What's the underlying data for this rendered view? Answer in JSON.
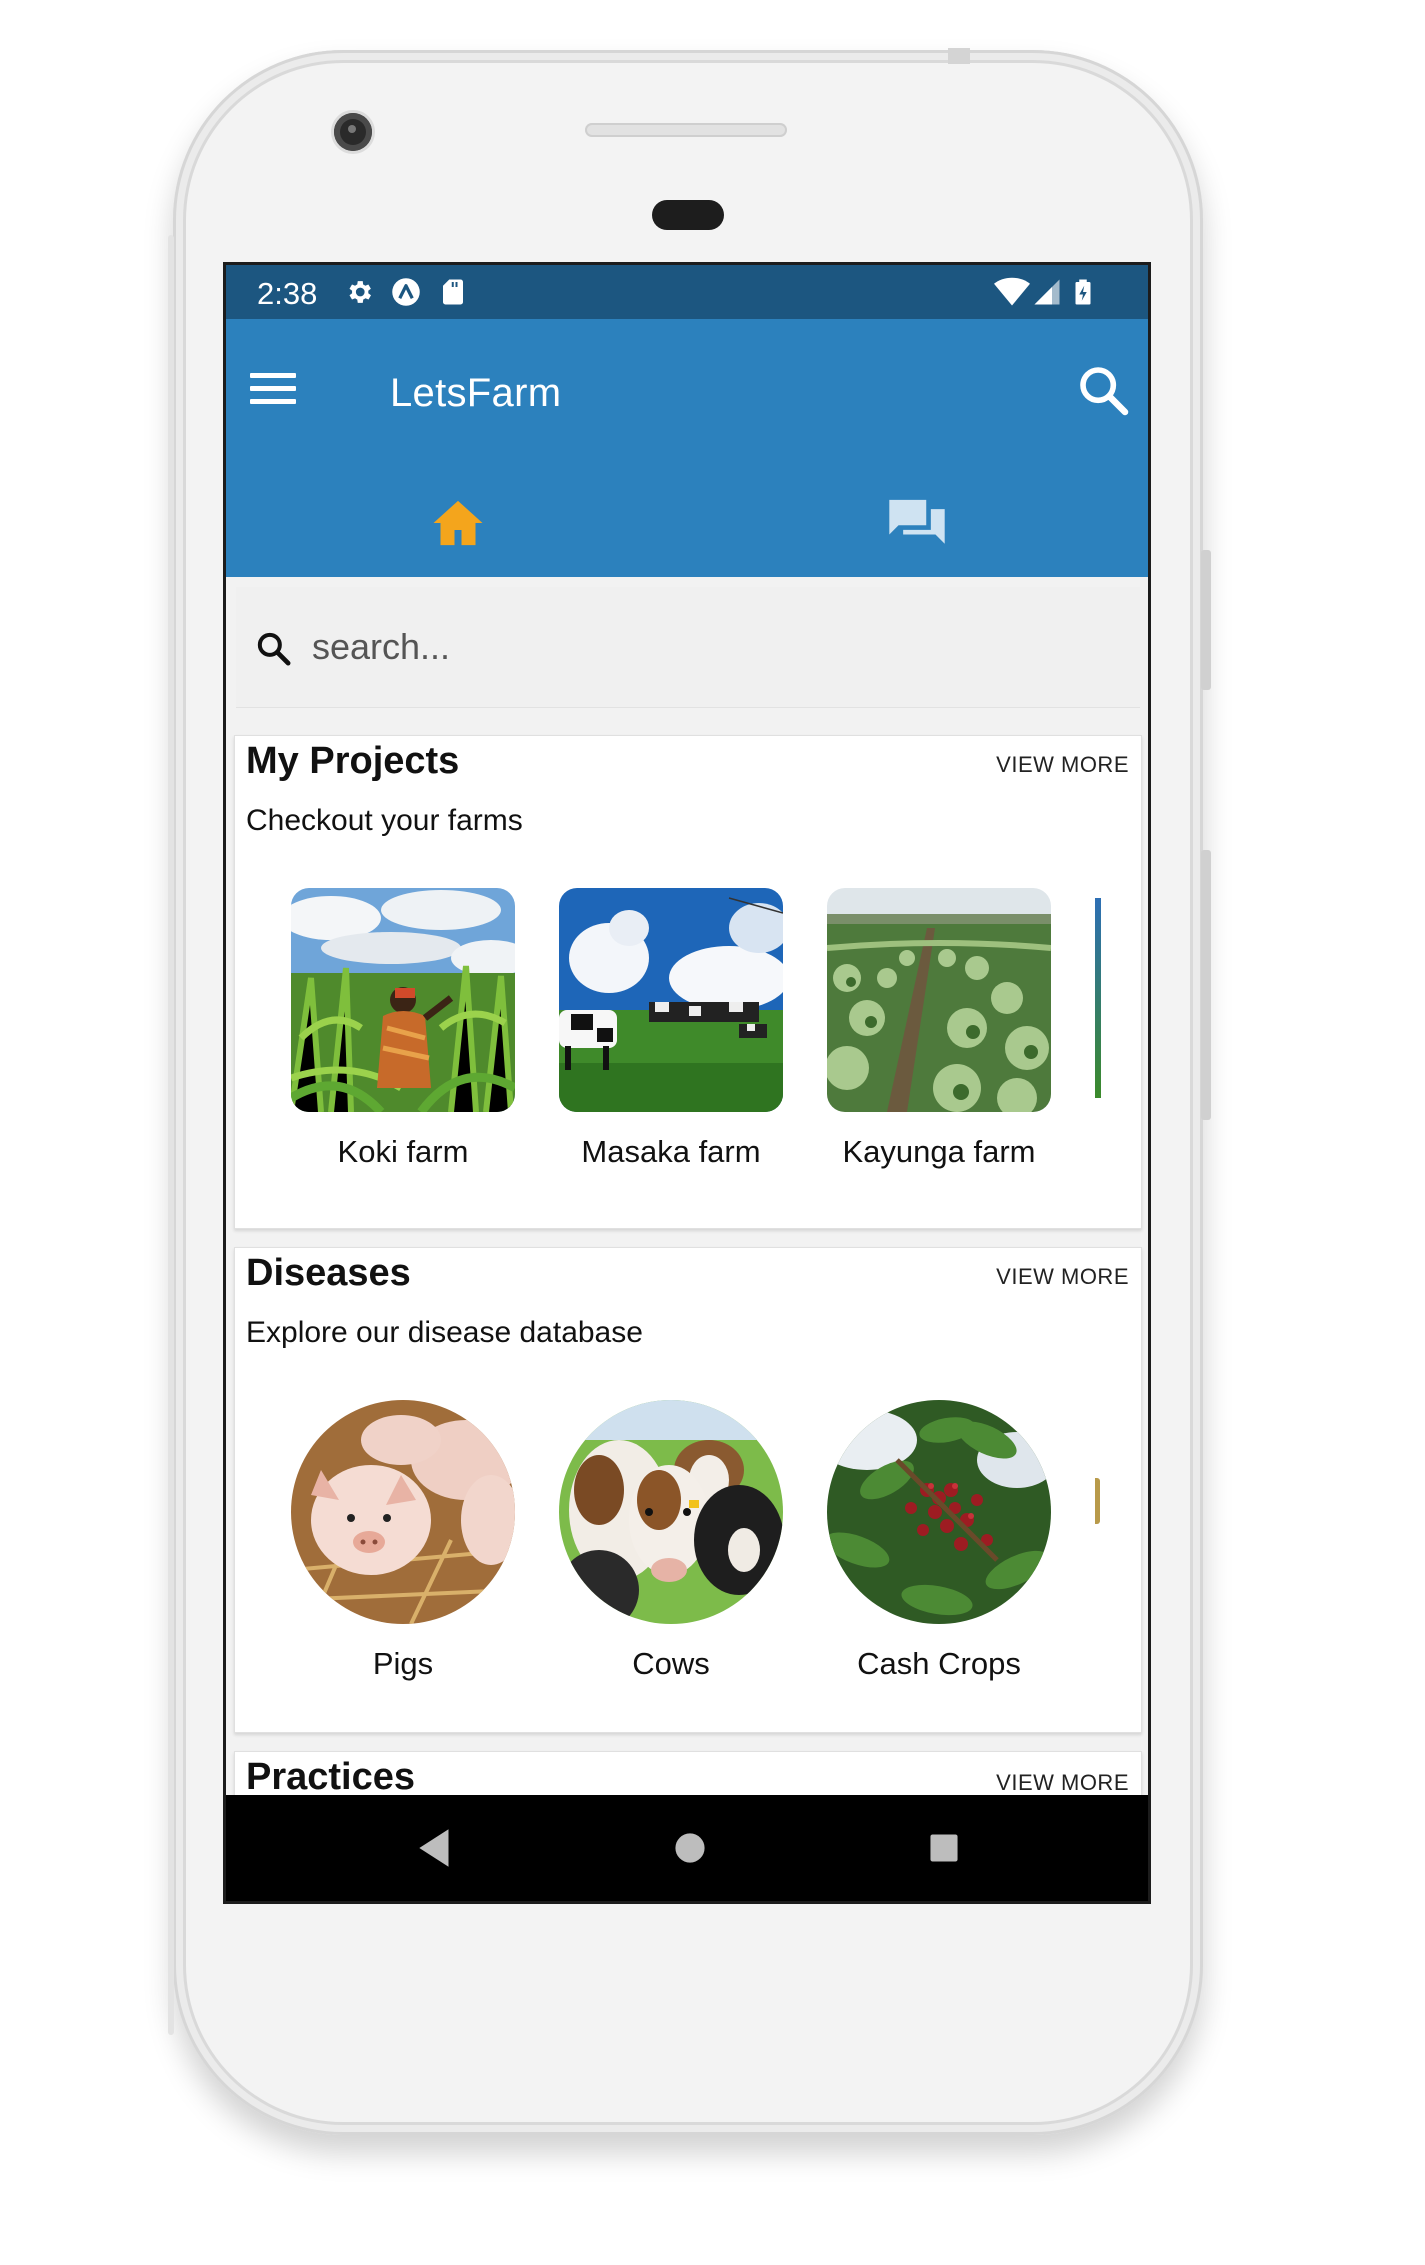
{
  "status_bar": {
    "time": "2:38",
    "left_icons": [
      "settings-icon",
      "a-circle-icon",
      "sd-card-icon"
    ],
    "right_icons": [
      "wifi-icon",
      "cell-signal-icon",
      "battery-icon"
    ]
  },
  "app_bar": {
    "title": "LetsFarm",
    "menu_icon": "hamburger-menu-icon",
    "search_icon": "search-icon",
    "color": "#2c81bd",
    "status_color": "#1c5680"
  },
  "tabs": [
    {
      "icon": "home-icon",
      "selected": true,
      "color": "#f4a51c"
    },
    {
      "icon": "chat-icon",
      "selected": false,
      "color": "#cfe3f2"
    }
  ],
  "search": {
    "placeholder": "search...",
    "value": ""
  },
  "sections": {
    "projects": {
      "title": "My Projects",
      "subtitle": "Checkout your farms",
      "view_more": "VIEW MORE",
      "items": [
        {
          "label": "Koki farm"
        },
        {
          "label": "Masaka farm"
        },
        {
          "label": "Kayunga farm"
        }
      ]
    },
    "diseases": {
      "title": "Diseases",
      "subtitle": "Explore our disease database",
      "view_more": "VIEW MORE",
      "items": [
        {
          "label": "Pigs"
        },
        {
          "label": "Cows"
        },
        {
          "label": "Cash Crops"
        }
      ]
    },
    "practices": {
      "title": "Practices",
      "view_more": "VIEW MORE"
    }
  },
  "nav_bar": {
    "buttons": [
      "back-icon",
      "home-circle-icon",
      "recents-square-icon"
    ]
  }
}
